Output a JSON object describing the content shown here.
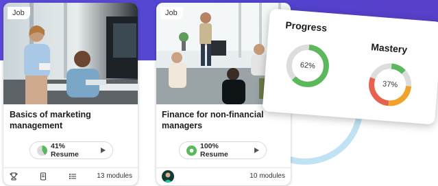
{
  "cards": [
    {
      "tag": "Job",
      "title": "Basics of marketing management",
      "progress_percent": 41,
      "resume_label": "41% Resume",
      "modules": "13 modules",
      "footer_icons": [
        "trophy-icon",
        "document-icon",
        "list-icon"
      ]
    },
    {
      "tag": "Job",
      "title": "Finance for non-financial managers",
      "progress_percent": 100,
      "resume_label": "100% Resume",
      "modules": "10 modules",
      "footer_icons": [
        "avatar"
      ]
    }
  ],
  "stats_panel": {
    "progress": {
      "label": "Progress",
      "value": "62%",
      "fraction": 0.62
    },
    "mastery": {
      "label": "Mastery",
      "value": "37%",
      "fraction": 0.37
    }
  },
  "colors": {
    "green": "#5cb85c",
    "amber": "#f0a32a",
    "red": "#e8614f",
    "track": "#dddddd",
    "band": "#5447d2",
    "circle": "#bfe3f4"
  }
}
